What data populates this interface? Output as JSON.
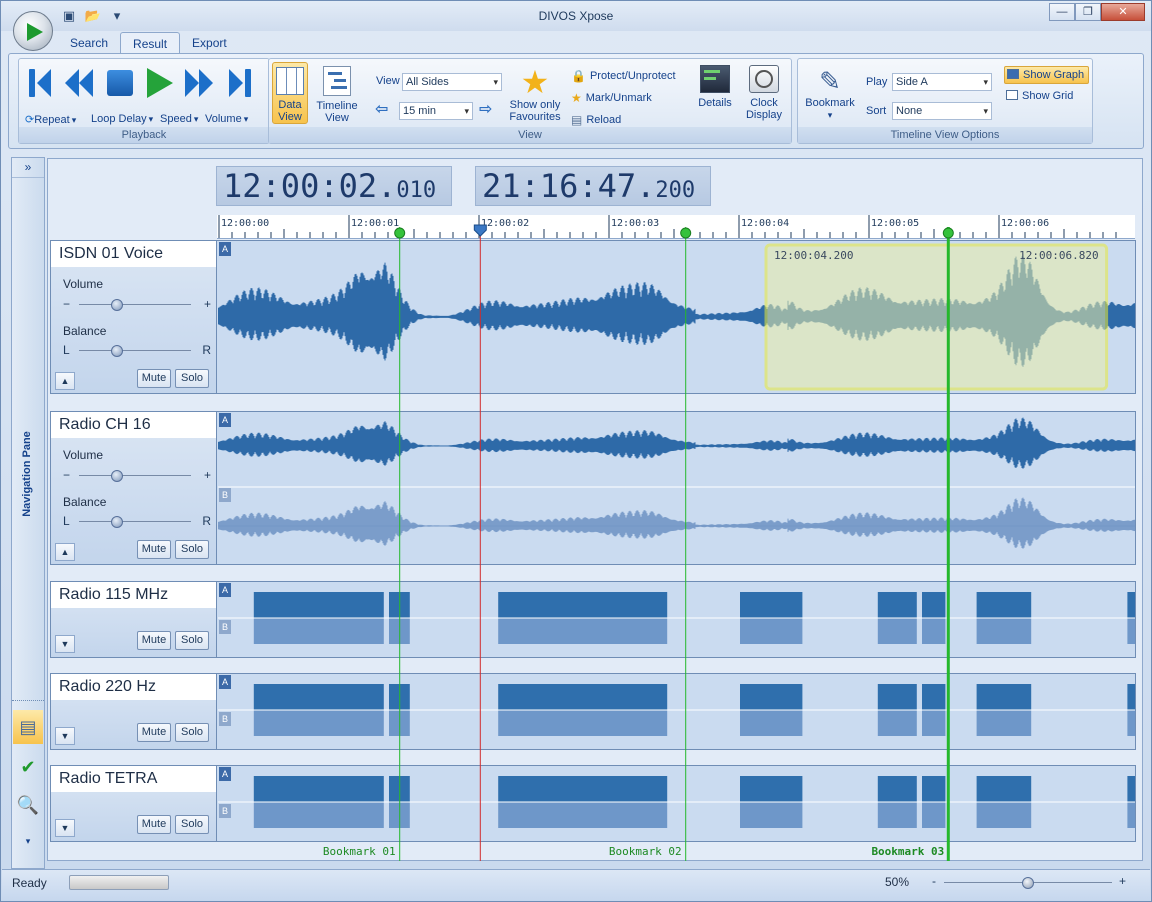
{
  "window": {
    "title": "DIVOS Xpose"
  },
  "quick_access": {
    "save_icon": "save-icon",
    "open_icon": "open-folder-icon",
    "customize": "▾"
  },
  "window_controls": {
    "minimize": "—",
    "restore": "❐",
    "close": "✕"
  },
  "tabs": [
    {
      "label": "Search",
      "active": false
    },
    {
      "label": "Result",
      "active": true
    },
    {
      "label": "Export",
      "active": false
    }
  ],
  "ribbon": {
    "playback": {
      "label": "Playback",
      "repeat": "Repeat",
      "loop_delay": "Loop Delay",
      "speed": "Speed",
      "volume": "Volume"
    },
    "view": {
      "label": "View",
      "data_view": "Data View",
      "timeline_view": "Timeline View",
      "view_label": "View",
      "view_value": "All Sides",
      "span_value": "15 min",
      "show_only_favourites": "Show only Favourites",
      "protect": "Protect/Unprotect",
      "mark": "Mark/Unmark",
      "reload": "Reload",
      "details": "Details",
      "clock_display": "Clock Display"
    },
    "timeline_options": {
      "label": "Timeline View Options",
      "bookmark": "Bookmark",
      "play_label": "Play",
      "play_value": "Side A",
      "sort_label": "Sort",
      "sort_value": "None",
      "show_graph": "Show Graph",
      "show_grid": "Show Grid"
    }
  },
  "nav_pane": {
    "label": "Navigation Pane",
    "collapse": "»"
  },
  "time_displays": {
    "current_main": "12:00:02.",
    "current_ms": "010",
    "clock_main": "21:16:47.",
    "clock_ms": "200"
  },
  "ruler": {
    "ticks": [
      "12:00:00",
      "12:00:01",
      "12:00:02",
      "12:00:03",
      "12:00:04",
      "12:00:05",
      "12:00:06"
    ]
  },
  "tracks": [
    {
      "name": "ISDN 01 Voice",
      "volume_label": "Volume",
      "balance_label": "Balance",
      "minus": "−",
      "plus": "+",
      "left": "L",
      "right": "R",
      "mute": "Mute",
      "solo": "Solo",
      "expand": "▲",
      "channels": [
        "A"
      ]
    },
    {
      "name": "Radio CH 16",
      "volume_label": "Volume",
      "balance_label": "Balance",
      "minus": "−",
      "plus": "+",
      "left": "L",
      "right": "R",
      "mute": "Mute",
      "solo": "Solo",
      "expand": "▲",
      "channels": [
        "A",
        "B"
      ]
    },
    {
      "name": "Radio 115 MHz",
      "mute": "Mute",
      "solo": "Solo",
      "expand": "▼",
      "channels": [
        "A",
        "B"
      ]
    },
    {
      "name": "Radio 220 Hz",
      "mute": "Mute",
      "solo": "Solo",
      "expand": "▼",
      "channels": [
        "A",
        "B"
      ]
    },
    {
      "name": "Radio TETRA",
      "mute": "Mute",
      "solo": "Solo",
      "expand": "▼",
      "channels": [
        "A",
        "B"
      ]
    }
  ],
  "selection": {
    "start": "12:00:04.200",
    "end": "12:00:06.820"
  },
  "bookmarks": [
    {
      "label": "Bookmark 01",
      "time": "12:00:01"
    },
    {
      "label": "Bookmark 02",
      "time": "12:00:03"
    },
    {
      "label": "Bookmark 03",
      "time": "12:00:05"
    }
  ],
  "status": {
    "text": "Ready",
    "zoom": "50%",
    "zoom_minus": "-",
    "zoom_plus": "+",
    "zoom_level": 0.5
  },
  "colors": {
    "accent": "#1c6fc9",
    "waveform": "#2e6aa8",
    "selection": "#ecec37",
    "bookmark": "#25b82c",
    "playhead": "#d12c2c"
  }
}
